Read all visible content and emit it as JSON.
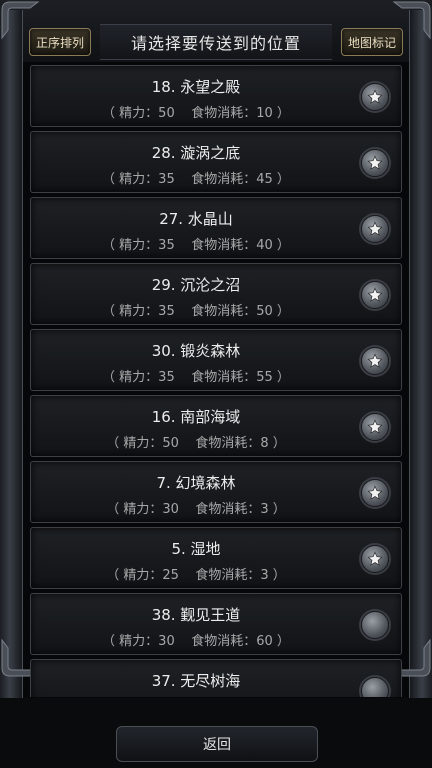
{
  "header": {
    "title": "请选择要传送到的位置",
    "sort_label": "正序排列",
    "map_mark_label": "地图标记"
  },
  "locations": [
    {
      "name": "18. 永望之殿",
      "detail": "（ 精力：50    食物消耗：10 ）",
      "starred": true
    },
    {
      "name": "28. 漩涡之底",
      "detail": "（ 精力：35    食物消耗：45 ）",
      "starred": true
    },
    {
      "name": "27. 水晶山",
      "detail": "（ 精力：35    食物消耗：40 ）",
      "starred": true
    },
    {
      "name": "29. 沉沦之沼",
      "detail": "（ 精力：35    食物消耗：50 ）",
      "starred": true
    },
    {
      "name": "30. 锻炎森林",
      "detail": "（ 精力：35    食物消耗：55 ）",
      "starred": true
    },
    {
      "name": "16. 南部海域",
      "detail": "（ 精力：50    食物消耗：8 ）",
      "starred": true
    },
    {
      "name": "7. 幻境森林",
      "detail": "（ 精力：30    食物消耗：3 ）",
      "starred": true
    },
    {
      "name": "5. 湿地",
      "detail": "（ 精力：25    食物消耗：3 ）",
      "starred": true
    },
    {
      "name": "38. 觐见王道",
      "detail": "（ 精力：30    食物消耗：60 ）",
      "starred": false
    },
    {
      "name": "37. 无尽树海",
      "detail": "",
      "starred": false
    }
  ],
  "footer": {
    "back_label": "返回"
  }
}
